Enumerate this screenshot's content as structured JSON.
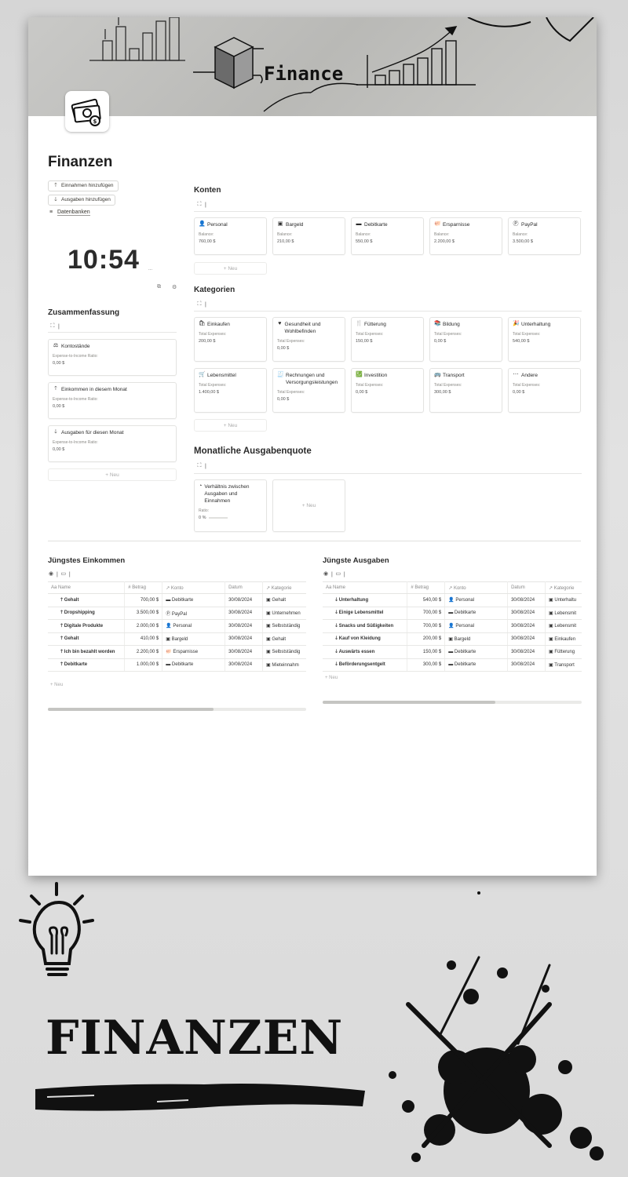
{
  "cover": {
    "label": "Finance"
  },
  "page": {
    "title": "Finanzen",
    "buttons": {
      "add_income": "Einnahmen hinzufügen",
      "add_expense": "Ausgaben hinzufügen"
    },
    "databases_link": "Datenbanken"
  },
  "clock": {
    "time": "10:54",
    "ampm": "..."
  },
  "summary": {
    "title": "Zusammenfassung",
    "cards": [
      {
        "title": "Kontostände",
        "label": "Expense-to-Income Ratio:",
        "value": "0,00 $"
      },
      {
        "title": "Einkommen in diesem Monat",
        "label": "Expense-to-Income Ratio:",
        "value": "0,00 $"
      },
      {
        "title": "Ausgaben für diesen Monat",
        "label": "Expense-to-Income Ratio:",
        "value": "0,00 $"
      }
    ],
    "new_label": "+ Neu"
  },
  "accounts": {
    "title": "Konten",
    "items": [
      {
        "name": "Personal",
        "label": "Balance:",
        "value": "760,00 $"
      },
      {
        "name": "Bargeld",
        "label": "Balance:",
        "value": "210,00 $"
      },
      {
        "name": "Debitkarte",
        "label": "Balance:",
        "value": "550,00 $"
      },
      {
        "name": "Ersparnisse",
        "label": "Balance:",
        "value": "2.200,00 $"
      },
      {
        "name": "PayPal",
        "label": "Balance:",
        "value": "3.500,00 $"
      }
    ],
    "new_label": "+ Neu"
  },
  "categories": {
    "title": "Kategorien",
    "items": [
      {
        "name": "Einkaufen",
        "label": "Total Expenses:",
        "value": "200,00 $"
      },
      {
        "name": "Gesundheit und Wohlbefinden",
        "label": "Total Expenses:",
        "value": "0,00 $"
      },
      {
        "name": "Fütterung",
        "label": "Total Expenses:",
        "value": "150,00 $"
      },
      {
        "name": "Bildung",
        "label": "Total Expenses:",
        "value": "0,00 $"
      },
      {
        "name": "Unterhaltung",
        "label": "Total Expenses:",
        "value": "540,00 $"
      },
      {
        "name": "Lebensmittel",
        "label": "Total Expenses:",
        "value": "1.400,00 $"
      },
      {
        "name": "Rechnungen und Versorgungsleistungen",
        "label": "Total Expenses:",
        "value": "0,00 $"
      },
      {
        "name": "Investition",
        "label": "Total Expenses:",
        "value": "0,00 $"
      },
      {
        "name": "Transport",
        "label": "Total Expenses:",
        "value": "300,00 $"
      },
      {
        "name": "Andere",
        "label": "Total Expenses:",
        "value": "0,00 $"
      }
    ],
    "new_label": "+ Neu"
  },
  "ratio": {
    "title": "Monatliche Ausgabenquote",
    "card": {
      "title": "Verhältnis zwischen Ausgaben und Einnahmen",
      "label": "Ratio:",
      "value": "0 %",
      "progress": 0
    },
    "new_label": "+ Neu"
  },
  "income": {
    "title": "Jüngstes Einkommen",
    "columns": [
      "Aa Name",
      "# Betrag",
      "↗ Konto",
      "Datum",
      "↗ Kategorie"
    ],
    "rows": [
      {
        "name": "Gehalt",
        "amount": "700,00 $",
        "account": "Debitkarte",
        "date": "30/08/2024",
        "category": "Gehalt"
      },
      {
        "name": "Dropshipping",
        "amount": "3.500,00 $",
        "account": "PayPal",
        "date": "30/08/2024",
        "category": "Unternehmen"
      },
      {
        "name": "Digitale Produkte",
        "amount": "2.000,00 $",
        "account": "Personal",
        "date": "30/08/2024",
        "category": "Selbstständig"
      },
      {
        "name": "Gehalt",
        "amount": "410,00 $",
        "account": "Bargeld",
        "date": "30/08/2024",
        "category": "Gehalt"
      },
      {
        "name": "Ich bin bezahlt worden",
        "amount": "2.200,00 $",
        "account": "Ersparnisse",
        "date": "30/08/2024",
        "category": "Selbstständig"
      },
      {
        "name": "Debitkarte",
        "amount": "1.000,00 $",
        "account": "Debitkarte",
        "date": "30/08/2024",
        "category": "Mieteinnahm"
      }
    ],
    "new_label": "+ Neu"
  },
  "expenses": {
    "title": "Jüngste Ausgaben",
    "columns": [
      "Aa Name",
      "# Betrag",
      "↗ Konto",
      "Datum",
      "↗ Kategorie"
    ],
    "rows": [
      {
        "name": "Unterhaltung",
        "amount": "540,00 $",
        "account": "Personal",
        "date": "30/08/2024",
        "category": "Unterhaltu"
      },
      {
        "name": "Einige Lebensmittel",
        "amount": "700,00 $",
        "account": "Debitkarte",
        "date": "30/08/2024",
        "category": "Lebensmit"
      },
      {
        "name": "Snacks und Süßigkeiten",
        "amount": "700,00 $",
        "account": "Personal",
        "date": "30/08/2024",
        "category": "Lebensmit"
      },
      {
        "name": "Kauf von Kleidung",
        "amount": "200,00 $",
        "account": "Bargeld",
        "date": "30/08/2024",
        "category": "Einkaufen"
      },
      {
        "name": "Auswärts essen",
        "amount": "150,00 $",
        "account": "Debitkarte",
        "date": "30/08/2024",
        "category": "Fütterung"
      },
      {
        "name": "Beförderungsentgelt",
        "amount": "300,00 $",
        "account": "Debitkarte",
        "date": "30/08/2024",
        "category": "Transport"
      }
    ],
    "new_label": "+ Neu"
  },
  "poster": {
    "title": "FINANZEN"
  }
}
